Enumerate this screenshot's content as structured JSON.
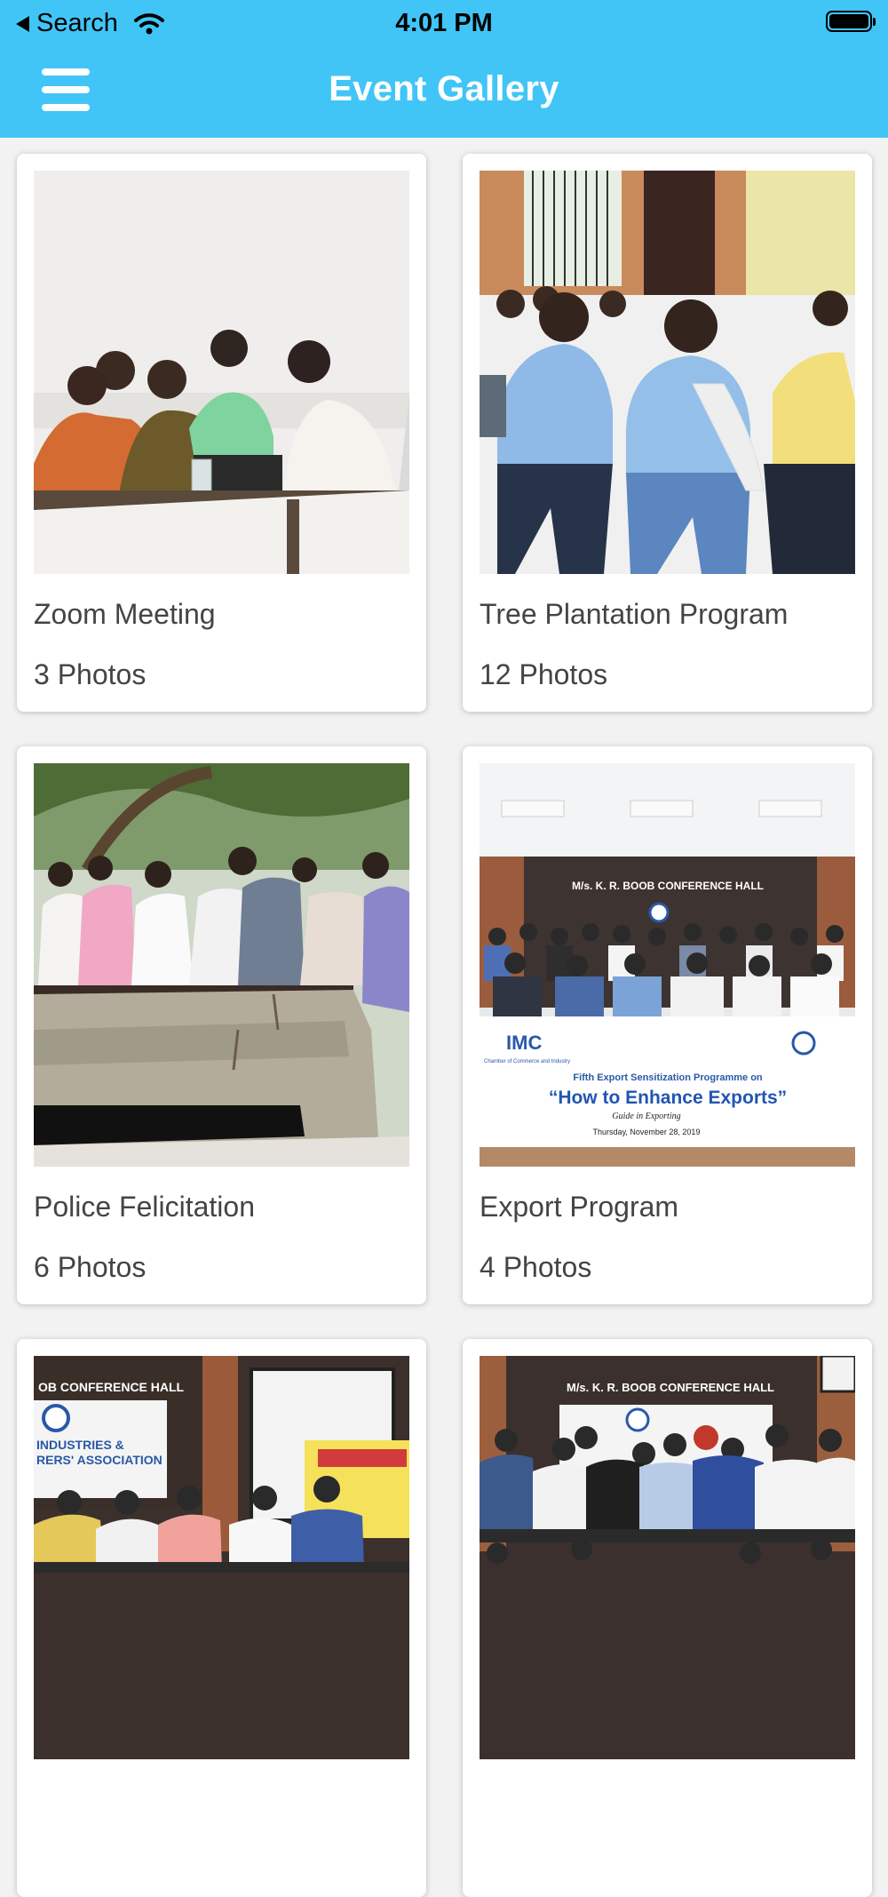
{
  "status_bar": {
    "back_label": "Search",
    "time": "4:01 PM"
  },
  "header": {
    "title": "Event Gallery",
    "menu_icon": "hamburger-menu-icon"
  },
  "events": [
    {
      "name": "Zoom Meeting",
      "photos": "3 Photos"
    },
    {
      "name": "Tree Plantation Program",
      "photos": "12 Photos"
    },
    {
      "name": "Police Felicitation",
      "photos": "6 Photos"
    },
    {
      "name": "Export Program",
      "photos": "4 Photos"
    },
    {
      "name": "",
      "photos": ""
    },
    {
      "name": "",
      "photos": ""
    }
  ],
  "photo_text": {
    "hall_sign": "M/s. K. R. BOOB CONFERENCE HALL",
    "banner_org": "IMC",
    "banner_sub": "Chamber of Commerce and Industry",
    "banner_line1": "Fifth Export Sensitization Programme on",
    "banner_line2": "“How to Enhance Exports”",
    "banner_line3": "Guide in Exporting",
    "banner_date": "Thursday, November 28, 2019",
    "hall_sign_short": "OB CONFERENCE HALL",
    "assoc_line1": "INDUSTRIES &",
    "assoc_line2": "RERS' ASSOCIATION"
  },
  "colors": {
    "header_bg": "#41c5f7",
    "page_bg": "#f2f2f2",
    "card_bg": "#ffffff"
  }
}
